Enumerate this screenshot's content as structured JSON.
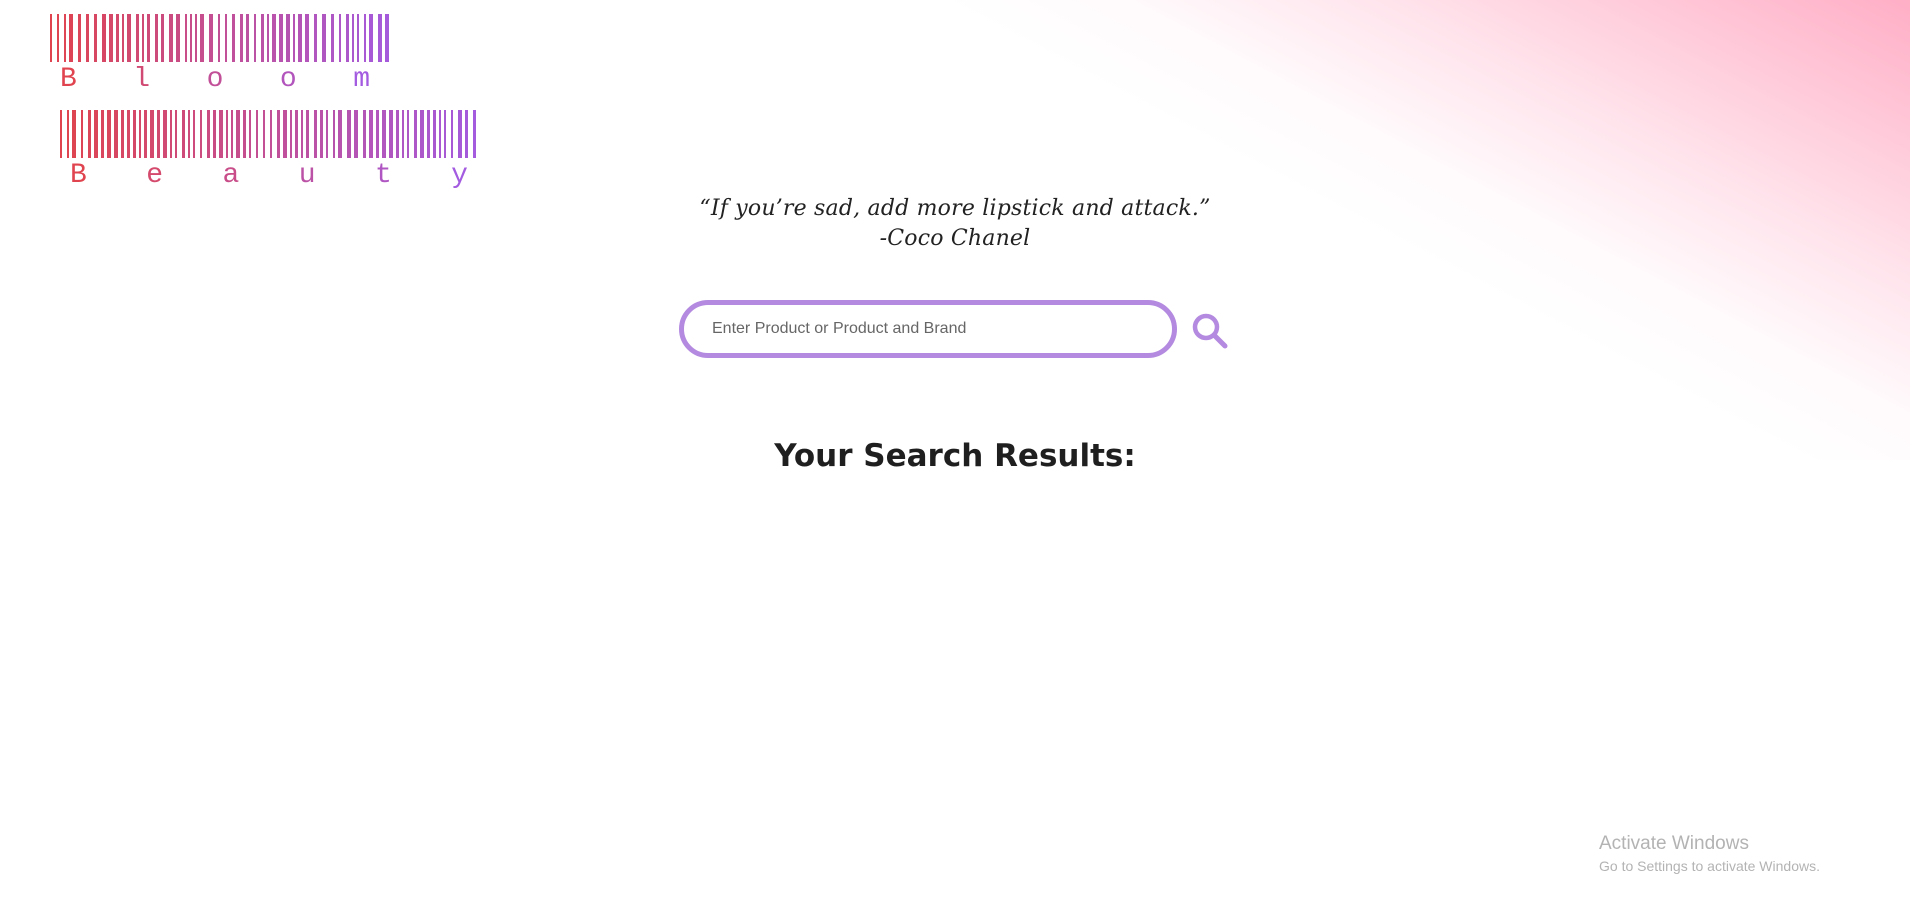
{
  "logo": {
    "line1": "Bloom",
    "line2": "Beauty"
  },
  "quote": {
    "text": "“If you’re sad, add more lipstick and attack.”",
    "author": "-Coco Chanel"
  },
  "search": {
    "placeholder": "Enter Product or Product and Brand",
    "value": ""
  },
  "results": {
    "title": "Your Search Results:"
  },
  "watermark": {
    "line1": "Activate Windows",
    "line2": "Go to Settings to activate Windows."
  },
  "colors": {
    "accent": "#b38ae0",
    "logo_start": "#e0444f",
    "logo_end": "#a35be0",
    "gradient_pink": "#ffaac3"
  },
  "icons": {
    "search": "search-icon"
  }
}
